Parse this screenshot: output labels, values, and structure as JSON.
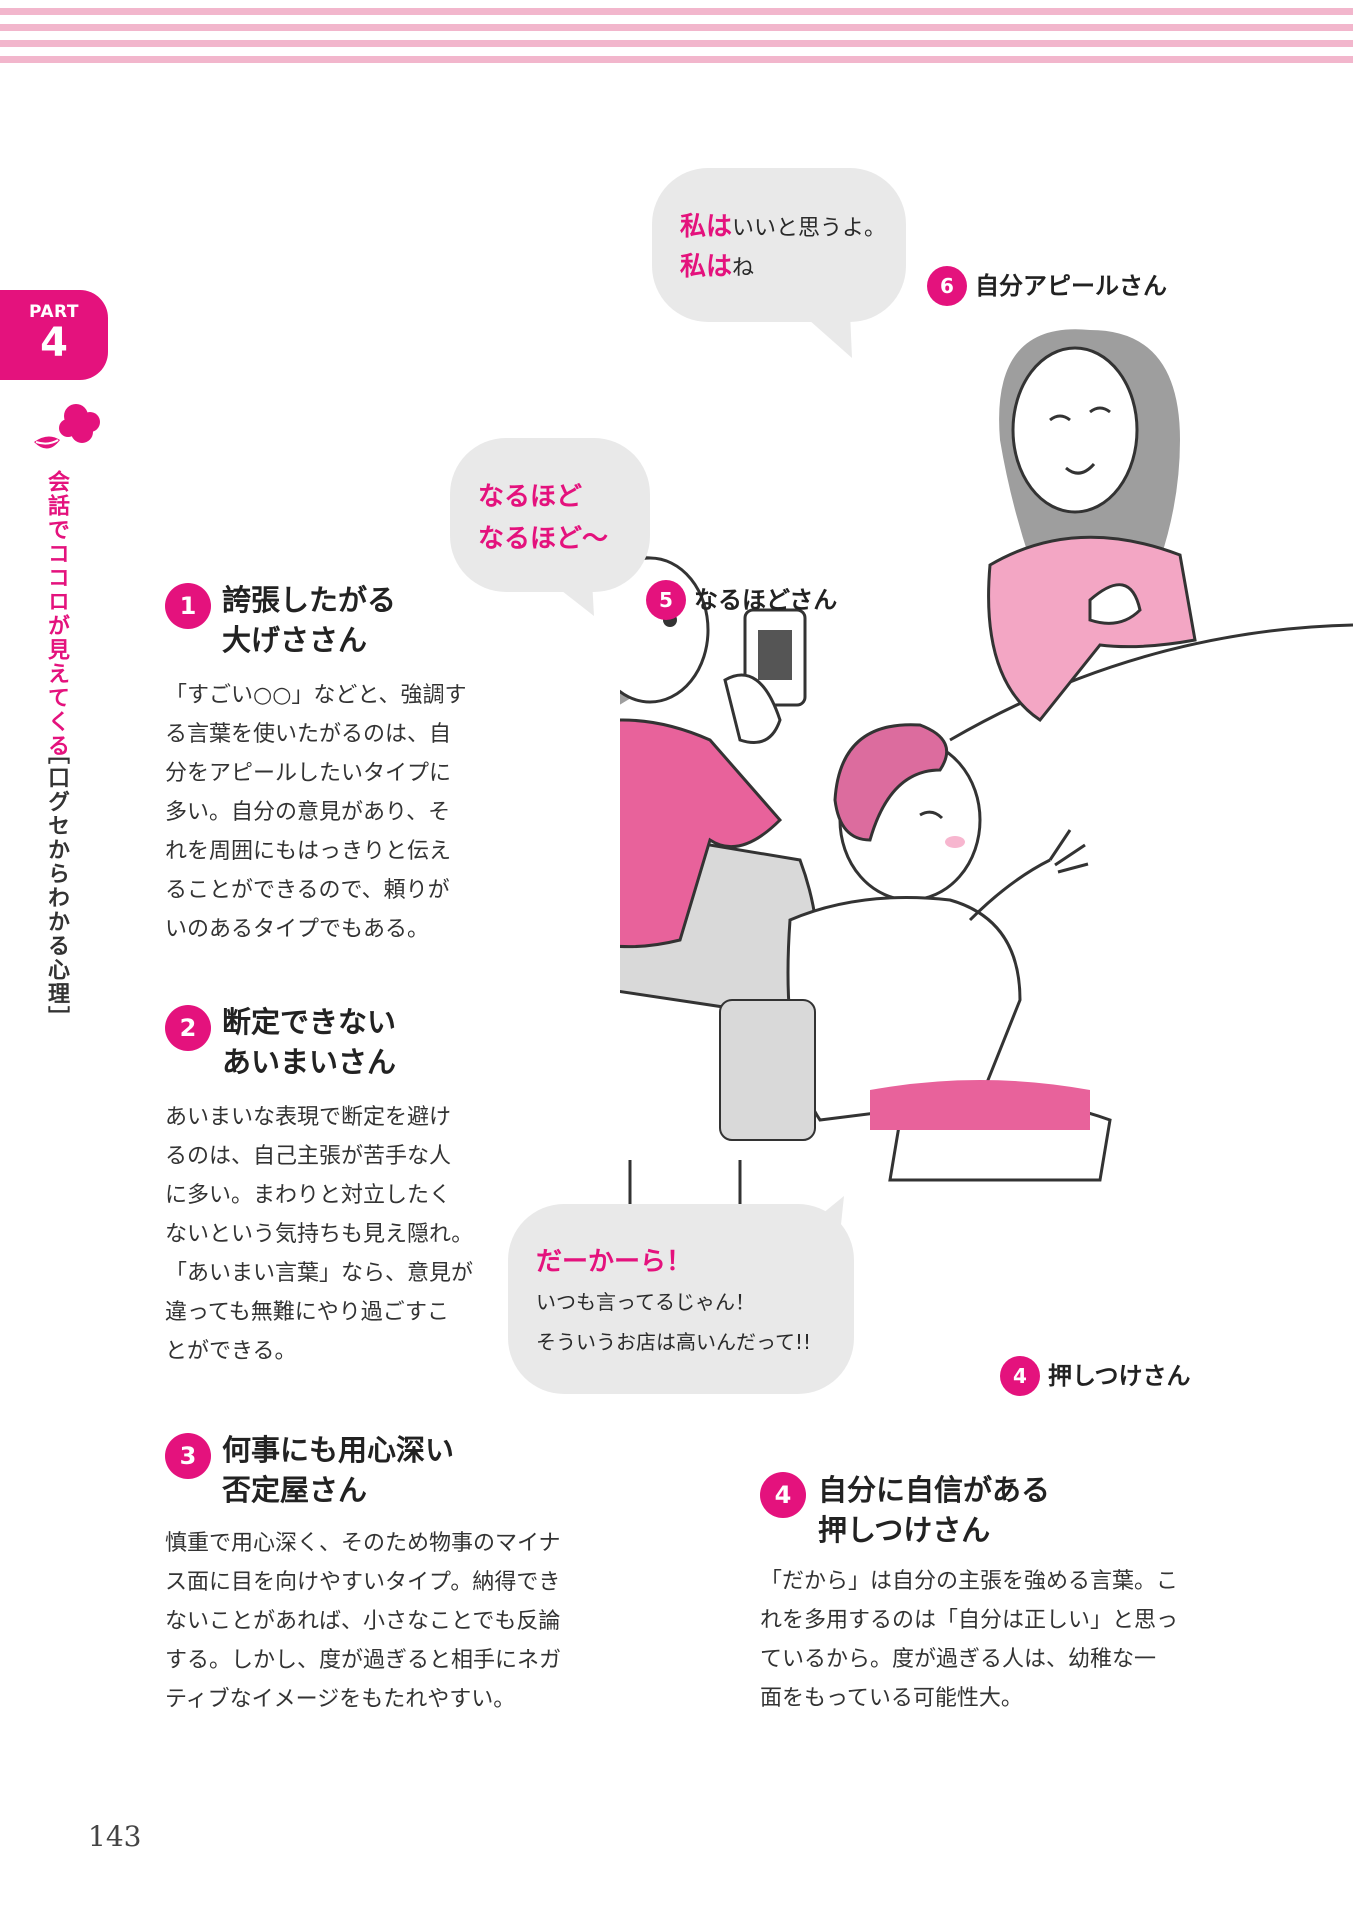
{
  "header": {
    "stripe_color": "#f2b6cc"
  },
  "sidebar": {
    "part_label": "PART",
    "part_number": "4",
    "chapter_title": "会話でココロが見えてくる",
    "chapter_subtitle": "［口グセからわかる心理］",
    "accent_color": "#e4127d",
    "icon": "lips-speech-icon"
  },
  "sections": [
    {
      "number": "1",
      "title_line1": "誇張したがる",
      "title_line2": "大げささん",
      "body": [
        "「すごい○○」などと、強調す",
        "る言葉を使いたがるのは、自",
        "分をアピールしたいタイプに",
        "多い。自分の意見があり、そ",
        "れを周囲にもはっきりと伝え",
        "ることができるので、頼りが",
        "いのあるタイプでもある。"
      ]
    },
    {
      "number": "2",
      "title_line1": "断定できない",
      "title_line2": "あいまいさん",
      "body": [
        "あいまいな表現で断定を避け",
        "るのは、自己主張が苦手な人",
        "に多い。まわりと対立したく",
        "ないという気持ちも見え隠れ。",
        "「あいまい言葉」なら、意見が",
        "違っても無難にやり過ごすこ",
        "とができる。"
      ]
    },
    {
      "number": "3",
      "title_line1": "何事にも用心深い",
      "title_line2": "否定屋さん",
      "body": [
        "慎重で用心深く、そのため物事のマイナ",
        "ス面に目を向けやすいタイプ。納得でき",
        "ないことがあれば、小さなことでも反論",
        "する。しかし、度が過ぎると相手にネガ",
        "ティブなイメージをもたれやすい。"
      ]
    },
    {
      "number": "4",
      "title_line1": "自分に自信がある",
      "title_line2": "押しつけさん",
      "body": [
        "「だから」は自分の主張を強める言葉。こ",
        "れを多用するのは「自分は正しい」と思っ",
        "ているから。度が過ぎる人は、幼稚な一",
        "面をもっている可能性大。"
      ]
    }
  ],
  "bubbles": {
    "b6": {
      "bold1": "私は",
      "rest1": "いいと思うよ。",
      "bold2": "私は",
      "rest2": "ね"
    },
    "b5": {
      "line1": "なるほど",
      "line2": "なるほど～"
    },
    "b4": {
      "line1": "だーかーら！",
      "line2": "いつも言ってるじゃん！",
      "line3": "そういうお店は高いんだって!!"
    }
  },
  "tags": {
    "t6": {
      "number": "6",
      "label": "自分アピールさん"
    },
    "t5": {
      "number": "5",
      "label": "なるほどさん"
    },
    "t4": {
      "number": "4",
      "label": "押しつけさん"
    }
  },
  "page_number": "143"
}
